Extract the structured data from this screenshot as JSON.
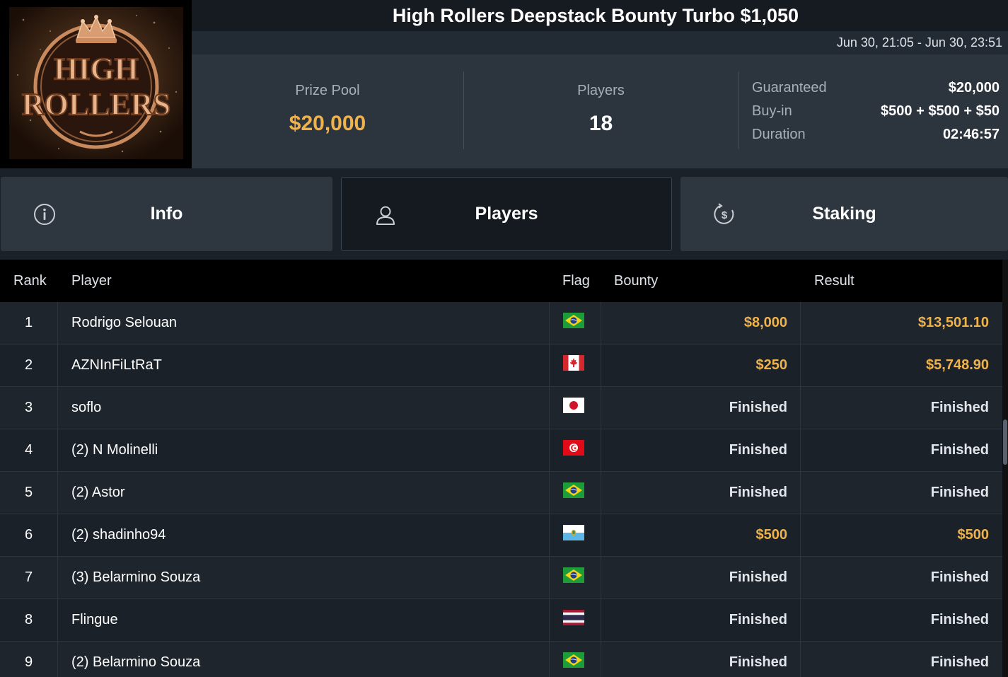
{
  "logo": {
    "line1": "HIGH",
    "line2": "ROLLERS"
  },
  "title": "High Rollers Deepstack Bounty Turbo $1,050",
  "date_range": "Jun 30, 21:05 - Jun 30, 23:51",
  "stats": {
    "prize_pool_label": "Prize Pool",
    "prize_pool_value": "$20,000",
    "players_label": "Players",
    "players_value": "18",
    "details": [
      {
        "label": "Guaranteed",
        "value": "$20,000"
      },
      {
        "label": "Buy-in",
        "value": "$500 + $500 + $50"
      },
      {
        "label": "Duration",
        "value": "02:46:57"
      }
    ]
  },
  "tabs": [
    {
      "label": "Info",
      "icon": "info-icon",
      "active": false
    },
    {
      "label": "Players",
      "icon": "user-icon",
      "active": true
    },
    {
      "label": "Staking",
      "icon": "dollar-icon",
      "active": false
    }
  ],
  "table": {
    "headers": {
      "rank": "Rank",
      "player": "Player",
      "flag": "Flag",
      "bounty": "Bounty",
      "result": "Result"
    },
    "rows": [
      {
        "rank": "1",
        "player": "Rodrigo Selouan",
        "flag": "brazil-flag",
        "bounty": "$8,000",
        "result": "$13,501.10"
      },
      {
        "rank": "2",
        "player": "AZNInFiLtRaT",
        "flag": "canada-flag",
        "bounty": "$250",
        "result": "$5,748.90"
      },
      {
        "rank": "3",
        "player": "soflo",
        "flag": "japan-flag",
        "bounty": "Finished",
        "result": "Finished"
      },
      {
        "rank": "4",
        "player": "(2) N Molinelli",
        "flag": "tunisia-flag",
        "bounty": "Finished",
        "result": "Finished"
      },
      {
        "rank": "5",
        "player": "(2) Astor",
        "flag": "brazil-flag",
        "bounty": "Finished",
        "result": "Finished"
      },
      {
        "rank": "6",
        "player": "(2) shadinho94",
        "flag": "san-marino-flag",
        "bounty": "$500",
        "result": "$500"
      },
      {
        "rank": "7",
        "player": "(3) Belarmino Souza",
        "flag": "brazil-flag",
        "bounty": "Finished",
        "result": "Finished"
      },
      {
        "rank": "8",
        "player": "Flingue",
        "flag": "thailand-flag",
        "bounty": "Finished",
        "result": "Finished"
      },
      {
        "rank": "9",
        "player": "(2) Belarmino Souza",
        "flag": "brazil-flag",
        "bounty": "Finished",
        "result": "Finished"
      }
    ]
  },
  "colors": {
    "gold": "#f0b34c",
    "background": "#1b2129",
    "panel": "#2c343e"
  }
}
